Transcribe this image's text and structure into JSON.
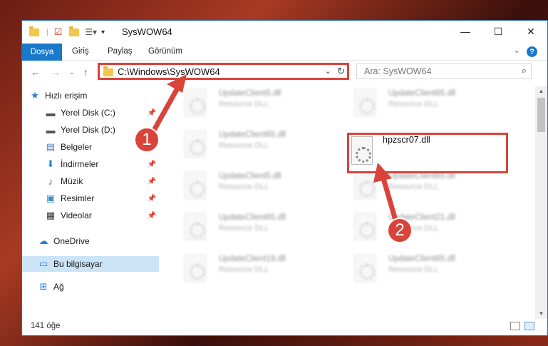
{
  "window": {
    "title": "SysWOW64",
    "controls": {
      "minimize": "—",
      "maximize": "☐",
      "close": "✕"
    }
  },
  "ribbon": {
    "tabs": [
      "Dosya",
      "Giriş",
      "Paylaş",
      "Görünüm"
    ]
  },
  "navigation": {
    "address": "C:\\Windows\\SysWOW64",
    "search_placeholder": "Ara: SysWOW64"
  },
  "sidebar": {
    "items": [
      {
        "label": "Hızlı erişim",
        "icon": "star-icon"
      },
      {
        "label": "Yerel Disk (C:)",
        "icon": "drive-icon",
        "pinned": true
      },
      {
        "label": "Yerel Disk (D:)",
        "icon": "drive-icon"
      },
      {
        "label": "Belgeler",
        "icon": "document-icon",
        "pinned": true
      },
      {
        "label": "İndirmeler",
        "icon": "download-icon",
        "pinned": true
      },
      {
        "label": "Müzik",
        "icon": "music-icon",
        "pinned": true
      },
      {
        "label": "Resimler",
        "icon": "pictures-icon",
        "pinned": true
      },
      {
        "label": "Videolar",
        "icon": "video-icon",
        "pinned": true
      },
      {
        "label": "OneDrive",
        "icon": "cloud-icon"
      },
      {
        "label": "Bu bilgisayar",
        "icon": "computer-icon",
        "selected": true
      },
      {
        "label": "Ağ",
        "icon": "network-icon"
      }
    ]
  },
  "files": {
    "left": [
      {
        "name": "UpdateClient5.dll",
        "type": "Resource DLL"
      },
      {
        "name": "UpdateClient65.dll",
        "type": "Resource DLL"
      },
      {
        "name": "UpdateClient5.dll",
        "type": "Resource DLL"
      },
      {
        "name": "UpdateClient65.dll",
        "type": "Resource DLL"
      },
      {
        "name": "UpdateClient19.dll",
        "type": "Resource DLL"
      }
    ],
    "right": [
      {
        "name": "UpdateClient65.dll",
        "type": "Resource DLL"
      },
      {
        "name": "UpdateClient65.dll",
        "type": "Resource DLL"
      },
      {
        "name": "UpdateClient21.dll",
        "type": "Resource DLL"
      },
      {
        "name": "UpdateClient65.dll",
        "type": "Resource DLL"
      }
    ],
    "highlighted": {
      "name": "hpzscr07.dll"
    }
  },
  "status": {
    "count": "141 öğe"
  },
  "annotations": {
    "step1": "1",
    "step2": "2",
    "color": "#d9433a"
  }
}
